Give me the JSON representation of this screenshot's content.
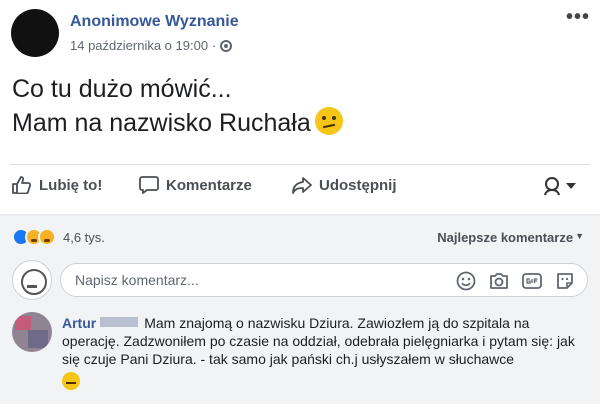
{
  "post": {
    "page_name": "Anonimowe Wyznanie",
    "date": "14 października o 19:00",
    "dot_separator": "·",
    "text_line1": "Co tu dużo mówić...",
    "text_line2": "Mam na nazwisko Ruchała"
  },
  "actions": {
    "like_label": "Lubię to!",
    "comment_label": "Komentarze",
    "share_label": "Udostępnij"
  },
  "reactions": {
    "count": "4,6 tys.",
    "sort_label": "Najlepsze komentarze"
  },
  "composer": {
    "placeholder": "Napisz komentarz..."
  },
  "comment": {
    "author": "Artur",
    "text": "Mam znajomą o nazwisku Dziura. Zawiozłem ją do szpitala na operację. Zadzwoniłem po czasie na oddział, odebrała pielęgniarka i pytam się: jak się czuje Pani Dziura. - tak samo jak pański ch.j usłyszałem w słuchawce"
  },
  "colors": {
    "page_name": "#365899",
    "comment_area_bg": "#f2f3f5",
    "action_text": "#4b4f56"
  }
}
